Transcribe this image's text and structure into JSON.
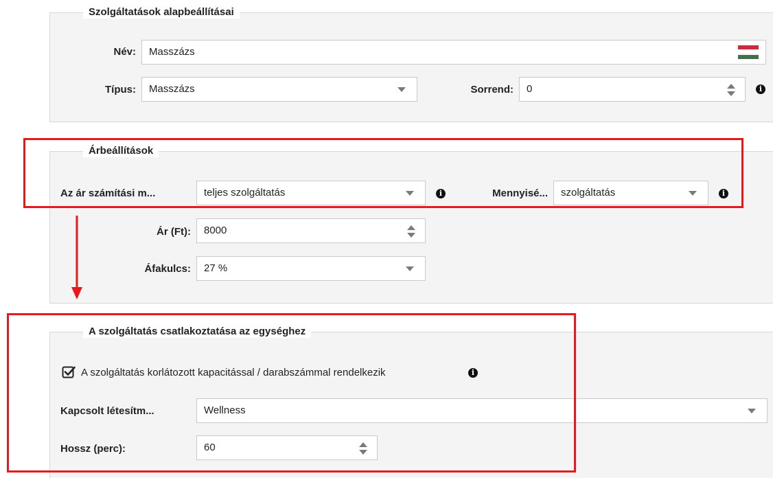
{
  "basic": {
    "legend": "Szolgáltatások alapbeállításai",
    "name_label": "Név:",
    "name_value": "Masszázs",
    "type_label": "Típus:",
    "type_value": "Masszázs",
    "order_label": "Sorrend:",
    "order_value": "0"
  },
  "price": {
    "legend": "Árbeállítások",
    "calc_label": "Az ár számítási m...",
    "calc_value": "teljes szolgáltatás",
    "qty_label": "Mennyisé...",
    "qty_value": "szolgáltatás",
    "price_label": "Ár (Ft):",
    "price_value": "8000",
    "vat_label": "Áfakulcs:",
    "vat_value": "27 %"
  },
  "unit": {
    "legend": "A szolgáltatás csatlakoztatása az egységhez",
    "capacity_checkbox_label": "A szolgáltatás korlátozott kapacitással / darabszámmal rendelkezik",
    "facility_label": "Kapcsolt létesítm...",
    "facility_value": "Wellness",
    "length_label": "Hossz (perc):",
    "length_value": "60"
  },
  "icons": {
    "info": "info-icon",
    "flag": "hungarian-flag-icon",
    "checkbox": "checkbox-checked-icon"
  },
  "colors": {
    "highlight": "#e8191c",
    "flag_red": "#cd2a3e",
    "flag_green": "#436f4d"
  }
}
